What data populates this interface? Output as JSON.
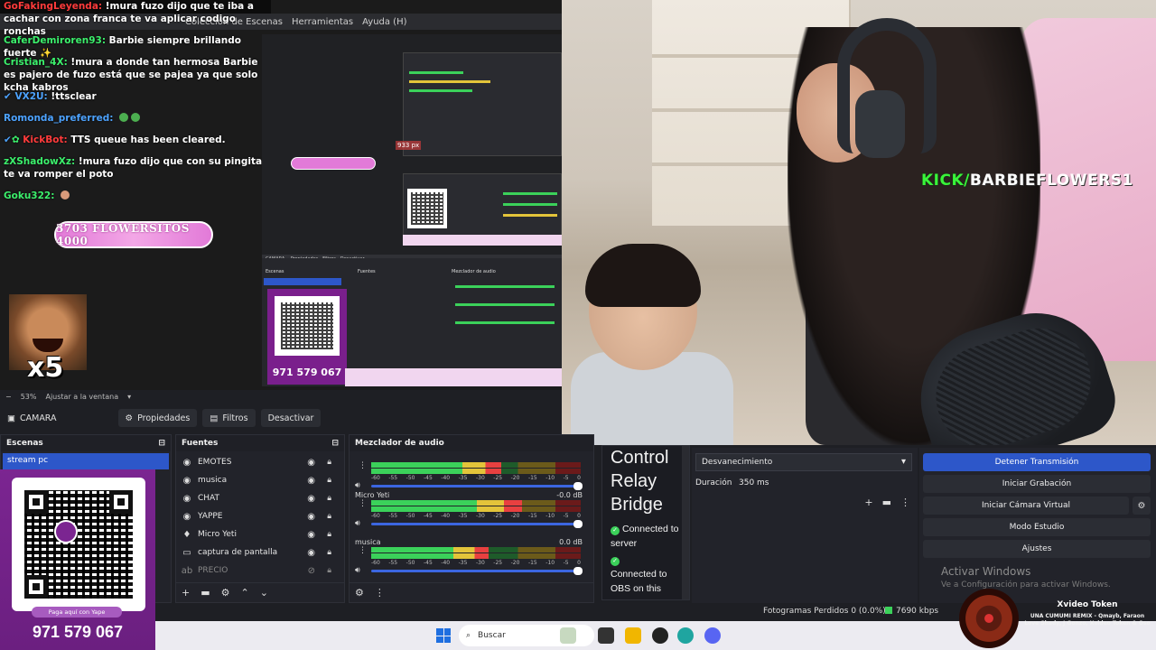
{
  "preview": {
    "menu": [
      "Colección de Escenas",
      "Herramientas",
      "Ayuda (H)"
    ],
    "chat": [
      {
        "user": "GoFakingLeyenda:",
        "color": "#ff3b3b",
        "text": "!mura fuzo dijo que te iba a cachar con zona franca te va aplicar codigo ronchas"
      },
      {
        "user": "CaferDemiroren93:",
        "color": "#3cf06c",
        "text": "Barbie siempre brillando fuerte ✨"
      },
      {
        "user": "Cristian_4X:",
        "color": "#3cf06c",
        "text": "!mura a donde tan hermosa Barbie es pajero de fuzo está que se pajea ya que solo kcha kabros"
      },
      {
        "user": "VX2U:",
        "color": "#4da3ff",
        "text": "!ttsclear"
      },
      {
        "user": "Romonda_preferred:",
        "color": "#3cf06c",
        "text": ""
      },
      {
        "user": "KickBot:",
        "color": "#ff3b3b",
        "text": "TTS queue has been cleared."
      },
      {
        "user": "zXShadowXz:",
        "color": "#3cf06c",
        "text": "!mura fuzo dijo que con su pingita te va romper el poto"
      },
      {
        "user": "Goku322:",
        "color": "#3cf06c",
        "text": ""
      }
    ],
    "goal_pill": "3703 FLOWERSITOS 4000",
    "x5_label": "x5",
    "zoom_value": "53%",
    "zoom_fit": "Ajustar a la ventana",
    "nested_phone": "971 579 067",
    "nested_px": "933 px"
  },
  "camera": {
    "kick_prefix": "KICK/",
    "kick_name": "BARBIEFLOWERS1",
    "kick_color": "#39f53a"
  },
  "toolbar": {
    "camera_label": "CAMARA",
    "properties_label": "Propiedades",
    "filters_label": "Filtros",
    "deactivate_label": "Desactivar"
  },
  "scenes": {
    "title": "Escenas",
    "items": [
      "stream pc"
    ],
    "qr_pill": "Paga aquí con Yape",
    "phone": "971 579 067"
  },
  "sources": {
    "title": "Fuentes",
    "items": [
      {
        "label": "EMOTES",
        "icon": "image-icon",
        "dim": false
      },
      {
        "label": "musica",
        "icon": "media-icon",
        "dim": false
      },
      {
        "label": "CHAT",
        "icon": "browser-icon",
        "dim": false
      },
      {
        "label": "YAPPE",
        "icon": "browser-icon",
        "dim": false
      },
      {
        "label": "Micro Yeti",
        "icon": "mic-icon",
        "dim": false
      },
      {
        "label": "captura de pantalla",
        "icon": "monitor-icon",
        "dim": false
      },
      {
        "label": "PRECIO",
        "icon": "text-icon",
        "dim": true
      }
    ]
  },
  "mixer": {
    "title": "Mezclador de audio",
    "channels": [
      {
        "name": "",
        "db": "",
        "level": 0.62
      },
      {
        "name": "Micro Yeti",
        "db": "-0.0 dB",
        "level": 0.72
      },
      {
        "name": "musica",
        "db": "0.0 dB",
        "level": 0.56
      }
    ],
    "ticks": [
      "-60",
      "-55",
      "-50",
      "-45",
      "-40",
      "-35",
      "-30",
      "-25",
      "-20",
      "-15",
      "-10",
      "-5",
      "0"
    ]
  },
  "relay": {
    "title_lines": [
      "Control",
      "Relay",
      "Bridge"
    ],
    "status1": "Connected to server",
    "status2": "Connected to OBS on this"
  },
  "transitions": {
    "selected": "Desvanecimiento",
    "duration_label": "Duración",
    "duration_value": "350 ms"
  },
  "controls": {
    "stop_stream": "Detener Transmisión",
    "start_recording": "Iniciar Grabación",
    "start_virtualcam": "Iniciar Cámara Virtual",
    "studio_mode": "Modo Estudio",
    "settings": "Ajustes",
    "activate_title": "Activar Windows",
    "activate_sub": "Ve a Configuración para activar Windows."
  },
  "status": {
    "frames_dropped": "Fotogramas Perdidos 0 (0.0%)",
    "bitrate": "7690 kbps"
  },
  "taskbar": {
    "search_placeholder": "Buscar"
  },
  "token_widget": {
    "title": "Xvideo Token",
    "song": "UNA CUMUMI REMIX - Qmayb, Faraon Love Shady, J Gonzo, Xvideo Token & Oso"
  }
}
